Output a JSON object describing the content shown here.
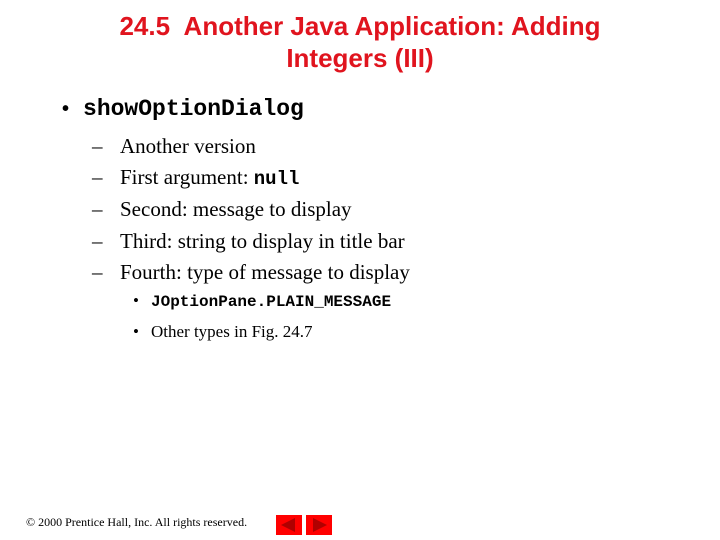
{
  "title": {
    "line1": "24.5  Another Java Application: Adding",
    "line2": "Integers (III)"
  },
  "main_bullet": {
    "glyph": "•",
    "text": "showOptionDialog"
  },
  "sub_items": [
    {
      "dash": "–",
      "text": "Another version",
      "code": ""
    },
    {
      "dash": "–",
      "text": "First argument: ",
      "code": "null"
    },
    {
      "dash": "–",
      "text": "Second: message to display",
      "code": ""
    },
    {
      "dash": "–",
      "text": "Third: string to display in title bar",
      "code": ""
    },
    {
      "dash": "–",
      "text": "Fourth: type of message to display",
      "code": ""
    }
  ],
  "sub_sub_items": [
    {
      "dot": "•",
      "code": "JOptionPane.PLAIN_MESSAGE",
      "text": ""
    },
    {
      "dot": "•",
      "code": "",
      "text": "Other types in Fig. 24.7"
    }
  ],
  "footer": {
    "copyright": "© 2000 Prentice Hall, Inc.  All rights reserved."
  },
  "nav": {
    "prev_icon": "previous-slide-arrow",
    "next_icon": "next-slide-arrow",
    "button_color": "#ff0000",
    "arrow_color": "#b00000"
  },
  "colors": {
    "title": "#e0141e"
  }
}
